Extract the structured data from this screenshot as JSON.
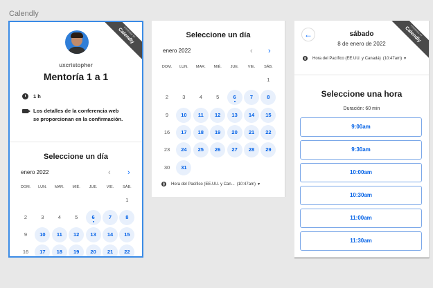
{
  "canvas": {
    "label": "Calendly"
  },
  "ribbon": {
    "small": "POWERED BY",
    "main": "Calendly"
  },
  "event": {
    "host": "uxcristopher",
    "title": "Mentoría 1 a 1",
    "duration": "1 h",
    "conference_note_line1": "Los detalles de la conferencia web",
    "conference_note_line2": "se proporcionan en la confirmación."
  },
  "calendar": {
    "title": "Seleccione un día",
    "month": "enero 2022",
    "prev_icon": "chevron-left-icon",
    "next_icon": "chevron-right-icon",
    "weekdays": [
      "DOM.",
      "LUN.",
      "MAR.",
      "MIÉ.",
      "JUE.",
      "VIE.",
      "SÁB."
    ],
    "weeks": [
      [
        "",
        "",
        "",
        "",
        "",
        "",
        "1"
      ],
      [
        "2",
        "3",
        "4",
        "5",
        "6",
        "7",
        "8"
      ],
      [
        "9",
        "10",
        "11",
        "12",
        "13",
        "14",
        "15"
      ],
      [
        "16",
        "17",
        "18",
        "19",
        "20",
        "21",
        "22"
      ],
      [
        "23",
        "24",
        "25",
        "26",
        "27",
        "28",
        "29"
      ],
      [
        "30",
        "31",
        "",
        "",
        "",
        "",
        ""
      ]
    ],
    "available": [
      "6",
      "7",
      "8",
      "10",
      "11",
      "12",
      "13",
      "14",
      "15",
      "17",
      "18",
      "19",
      "20",
      "21",
      "22",
      "24",
      "25",
      "26",
      "27",
      "28",
      "29",
      "31"
    ],
    "today": "6",
    "timezone": "Hora del Pacífico (EE.UU. y Can...",
    "time_now": "(10:47am)"
  },
  "time_select": {
    "day": "sábado",
    "date": "8 de enero de 2022",
    "timezone": "Hora del Pacífico (EE.UU. y Canadá)",
    "time_now": "(10:47am)",
    "title": "Seleccione una hora",
    "duration": "Duración: 60 min",
    "slots": [
      "9:00am",
      "9:30am",
      "10:00am",
      "10:30am",
      "11:00am",
      "11:30am"
    ]
  },
  "colors": {
    "accent": "#0069ff",
    "available_bg": "#e8f0fc",
    "selection": "#3a8be6"
  }
}
